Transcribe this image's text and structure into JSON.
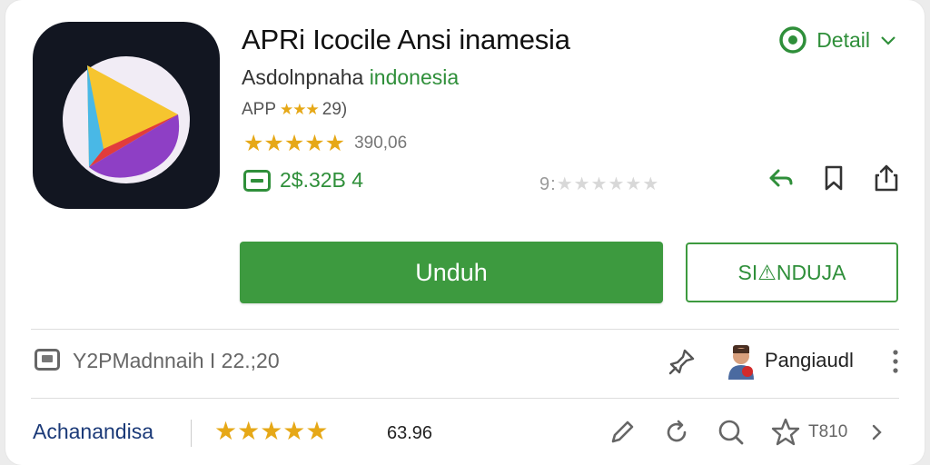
{
  "app": {
    "title": "APRi Icocile Ansi inamesia",
    "subtitle_main": "Asdolnpnaha ",
    "subtitle_accent": "indonesia",
    "app_label": "APP",
    "app_mini_stars": "★★★",
    "app_count": "29)",
    "stars": "★★★★★",
    "rating_count": "390,06",
    "price": "2$.32B 4",
    "faint_rating_prefix": "9:",
    "faint_rating_stars": "★★★★★★",
    "icon_colors": {
      "background": "#121621",
      "disc": "#f1ecf5",
      "yellow": "#f6c52f",
      "blue": "#49b8e6",
      "red": "#e23c3c",
      "purple": "#8e3fc5"
    }
  },
  "header": {
    "detail_label": "Detail"
  },
  "buttons": {
    "primary_label": "Unduh",
    "secondary_label": "SI⚠NDUJA"
  },
  "meta": {
    "text": "Y2PMadnnaih  I 22.;20",
    "user_name": "Pangiaudl"
  },
  "review": {
    "author": "Achanandisa",
    "stars": "★★★★★",
    "score": "63.96",
    "star_count": "T810"
  },
  "colors": {
    "accent": "#3d9a3f",
    "accent_text": "#2f8f3a",
    "star": "#e6a817"
  }
}
